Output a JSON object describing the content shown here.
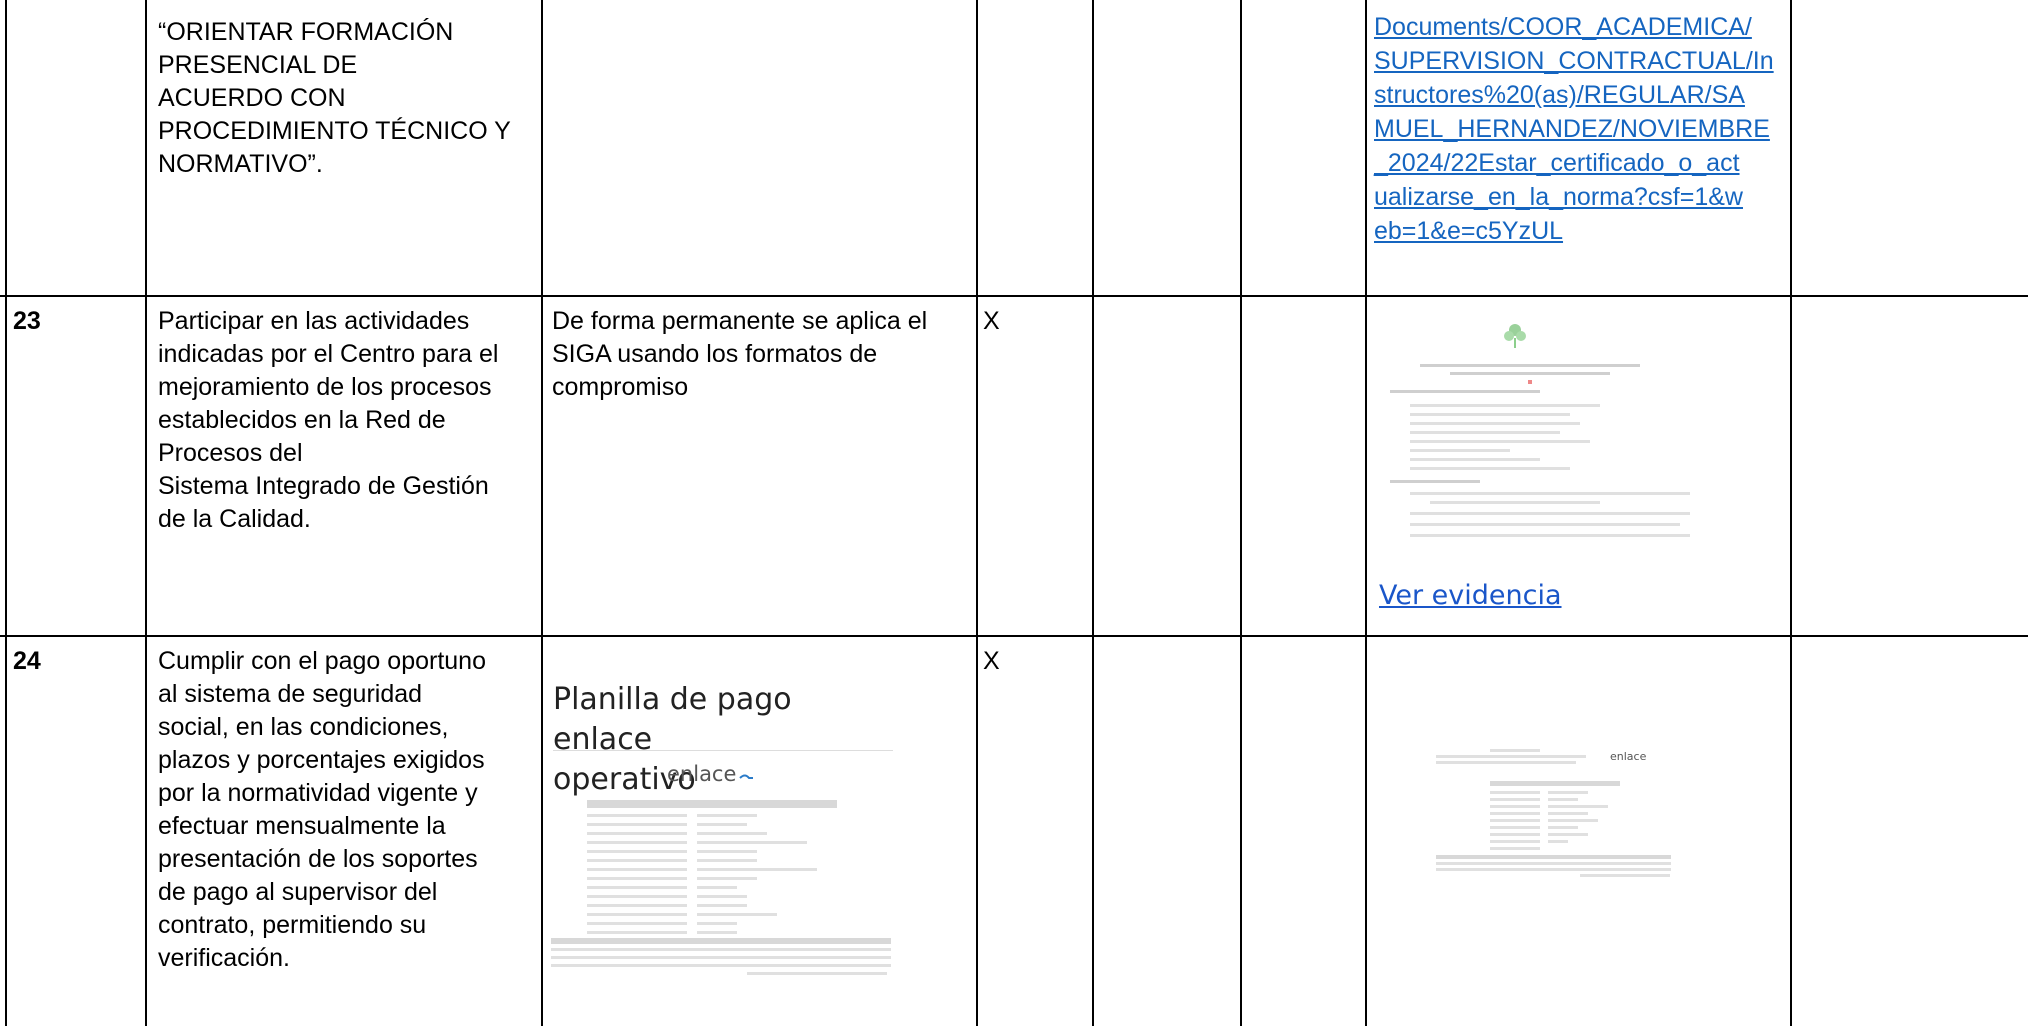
{
  "rows": [
    {
      "number": "",
      "obligation_lines": [
        "“ORIENTAR FORMACIÓN",
        "PRESENCIAL DE",
        "ACUERDO CON",
        "PROCEDIMIENTO TÉCNICO Y",
        "NORMATIVO”."
      ],
      "evidence_link_lines": [
        "Documents/COOR_ACADEMICA/",
        "SUPERVISION_CONTRACTUAL/In",
        "structores%20(as)/REGULAR/SA",
        "MUEL_HERNANDEZ/NOVIEMBRE",
        "_2024/22Estar_certificado_o_act",
        "ualizarse_en_la_norma?csf=1&w",
        "eb=1&e=c5YzUL"
      ]
    },
    {
      "number": "23",
      "obligation_lines": [
        "Participar en las actividades",
        "indicadas por el Centro para el",
        "mejoramiento de los procesos",
        "establecidos en la Red de",
        "Procesos del",
        "Sistema Integrado de Gestión",
        "de la Calidad."
      ],
      "description_lines": [
        "De forma permanente se aplica el",
        "SIGA usando los formatos de",
        "compromiso"
      ],
      "check": "X",
      "evidence_link_text": "Ver evidencia"
    },
    {
      "number": "24",
      "obligation_lines": [
        "Cumplir con el pago oportuno",
        "al sistema de seguridad",
        "social, en las condiciones,",
        "plazos y porcentajes exigidos",
        "por la normatividad vigente y",
        "efectuar mensualmente la",
        "presentación de los soportes",
        "de pago al supervisor del",
        "contrato, permitiendo su",
        "verificación."
      ],
      "planilla_title_lines": [
        "Planilla de pago enlace",
        "operativo"
      ],
      "brand": "enlace",
      "check": "X"
    }
  ],
  "colors": {
    "link": "#1565c0",
    "border": "#000000"
  }
}
